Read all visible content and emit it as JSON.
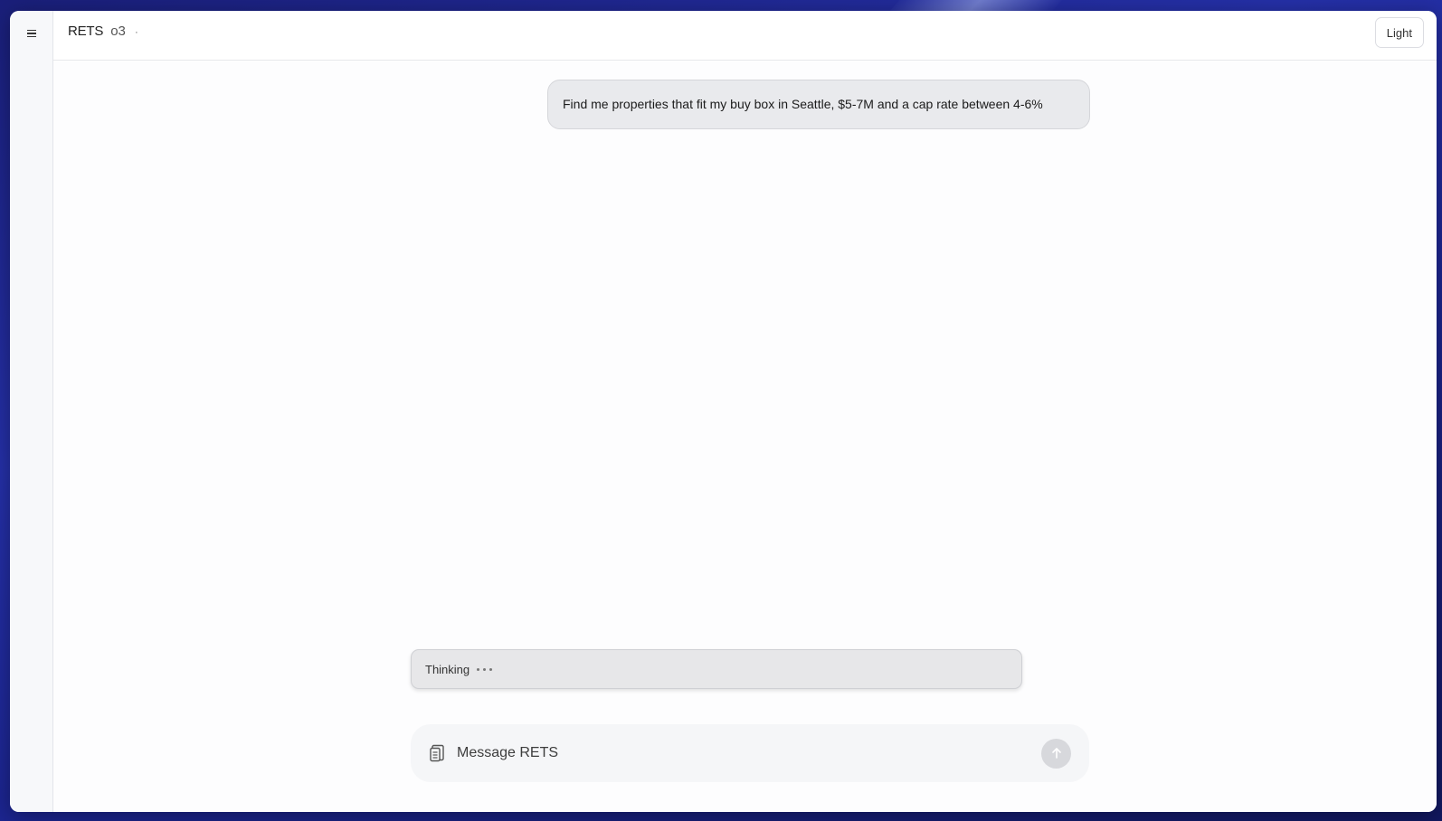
{
  "header": {
    "app_title": "RETS",
    "model_name": "o3",
    "model_dot": "·",
    "theme_button_label": "Light"
  },
  "sidebar": {
    "menu_icon": "hamburger-menu-icon"
  },
  "chat": {
    "messages": [
      {
        "role": "user",
        "text": "Find me properties that fit my buy box in Seattle, $5-7M and a cap rate between 4-6%"
      }
    ],
    "status": {
      "label": "Thinking",
      "icon": "ellipsis-icon"
    }
  },
  "composer": {
    "placeholder": "Message RETS",
    "attach_icon": "attach-file-icon",
    "send_icon": "arrow-up-icon"
  },
  "colors": {
    "backdrop": "#2530a8",
    "bubble_bg": "#e9eaed",
    "send_button": "#d7d8dc"
  }
}
